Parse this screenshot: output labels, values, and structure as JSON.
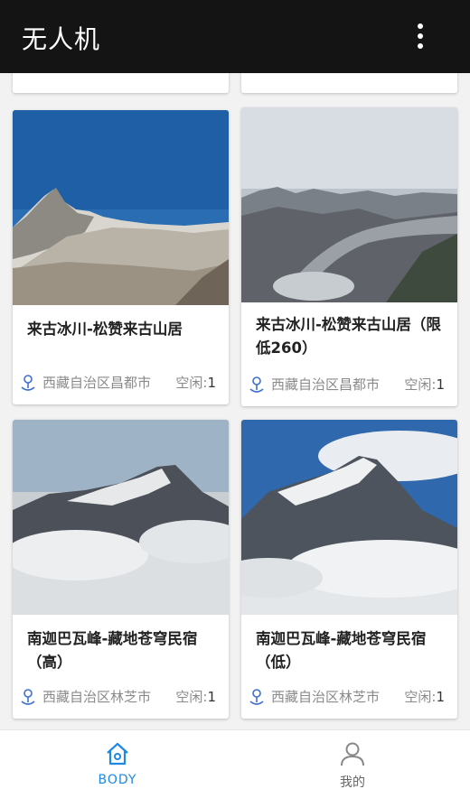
{
  "app": {
    "title": "无人机"
  },
  "cards": [
    {
      "name": "来古冰川-松赞来古山居",
      "location": "西藏自治区昌都市",
      "idle_label": "空闲:",
      "idle_count": "1"
    },
    {
      "name": "来古冰川-松赞来古山居（限低260）",
      "location": "西藏自治区昌都市",
      "idle_label": "空闲:",
      "idle_count": "1"
    },
    {
      "name": "南迦巴瓦峰-藏地苍穹民宿（高）",
      "location": "西藏自治区林芝市",
      "idle_label": "空闲:",
      "idle_count": "1"
    },
    {
      "name": "南迦巴瓦峰-藏地苍穹民宿（低）",
      "location": "西藏自治区林芝市",
      "idle_label": "空闲:",
      "idle_count": "1"
    }
  ],
  "nav": {
    "body_label": "BODY",
    "mine_label": "我的"
  },
  "colors": {
    "appbar": "#141414",
    "accent": "#1e88e5",
    "pin": "#3d6fd1"
  },
  "icons": {
    "menu": "more-vert-icon",
    "home": "home-icon",
    "profile": "person-icon",
    "location": "map-pin-icon"
  }
}
